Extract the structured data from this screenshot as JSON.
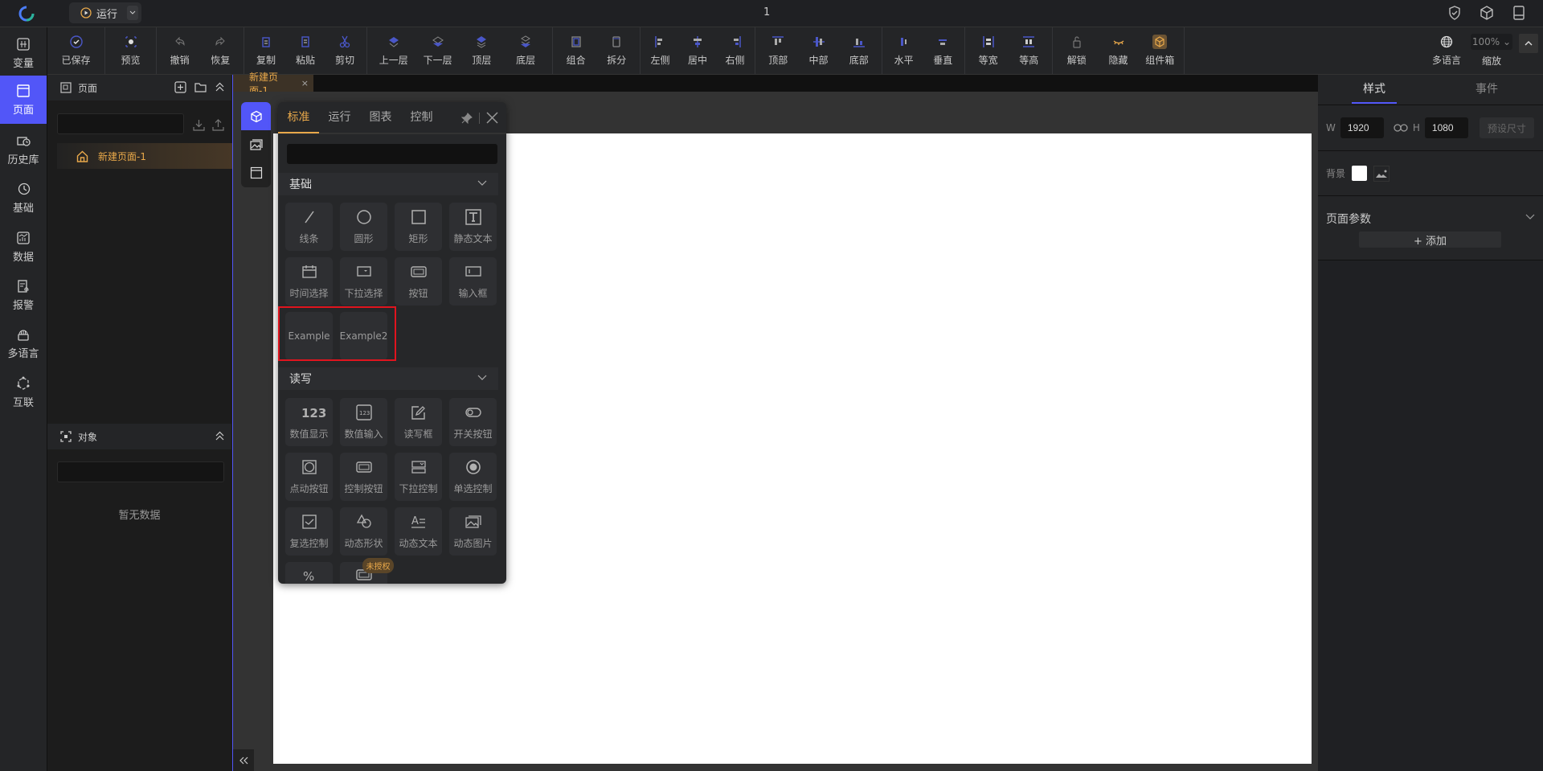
{
  "app": {
    "title": "1",
    "run_label": "运行"
  },
  "colors": {
    "accent": "#5256f8",
    "highlight": "#e8a84a",
    "danger": "#e0141e"
  },
  "toolbar": {
    "groups": [
      [
        {
          "label": "已保存",
          "icon": "check-circle-icon"
        }
      ],
      [
        {
          "label": "预览",
          "icon": "eye-icon"
        }
      ],
      [
        {
          "label": "撤销",
          "icon": "undo-icon"
        },
        {
          "label": "恢复",
          "icon": "redo-icon"
        }
      ],
      [
        {
          "label": "复制",
          "icon": "copy-icon"
        },
        {
          "label": "粘贴",
          "icon": "paste-icon"
        },
        {
          "label": "剪切",
          "icon": "scissors-icon"
        }
      ],
      [
        {
          "label": "上一层",
          "icon": "layer-up-icon"
        },
        {
          "label": "下一层",
          "icon": "layer-down-icon"
        },
        {
          "label": "顶层",
          "icon": "layer-top-icon"
        },
        {
          "label": "底层",
          "icon": "layer-bottom-icon"
        }
      ],
      [
        {
          "label": "组合",
          "icon": "group-icon"
        },
        {
          "label": "拆分",
          "icon": "ungroup-icon"
        }
      ],
      [
        {
          "label": "左侧",
          "icon": "align-left-icon"
        },
        {
          "label": "居中",
          "icon": "align-center-icon"
        },
        {
          "label": "右侧",
          "icon": "align-right-icon"
        }
      ],
      [
        {
          "label": "顶部",
          "icon": "align-top-icon"
        },
        {
          "label": "中部",
          "icon": "align-middle-icon"
        },
        {
          "label": "底部",
          "icon": "align-bottom-icon"
        }
      ],
      [
        {
          "label": "水平",
          "icon": "distribute-horizontal-icon"
        },
        {
          "label": "垂直",
          "icon": "distribute-vertical-icon"
        }
      ],
      [
        {
          "label": "等宽",
          "icon": "equal-width-icon"
        },
        {
          "label": "等高",
          "icon": "equal-height-icon"
        }
      ],
      [
        {
          "label": "解锁",
          "icon": "unlock-icon"
        },
        {
          "label": "隐藏",
          "icon": "eye-closed-icon"
        },
        {
          "label": "组件箱",
          "icon": "component-box-icon"
        }
      ]
    ],
    "language_label": "多语言",
    "zoom_label": "缩放",
    "zoom_value": "100%"
  },
  "nav": [
    {
      "label": "变量",
      "icon": "variable-icon"
    },
    {
      "label": "页面",
      "icon": "page-icon",
      "active": true
    },
    {
      "label": "历史库",
      "icon": "history-db-icon"
    },
    {
      "label": "基础",
      "icon": "clock-icon"
    },
    {
      "label": "数据",
      "icon": "chart-icon"
    },
    {
      "label": "报警",
      "icon": "alarm-icon"
    },
    {
      "label": "多语言",
      "icon": "language-icon"
    },
    {
      "label": "互联",
      "icon": "network-icon"
    }
  ],
  "pages_panel": {
    "title": "页面",
    "search_value": "",
    "items": [
      {
        "label": "新建页面-1",
        "home": true
      }
    ]
  },
  "objects_panel": {
    "title": "对象",
    "search_value": "",
    "empty_text": "暂无数据"
  },
  "editor_tabs": [
    {
      "label": "新建页面-1"
    }
  ],
  "palette": {
    "tabs": [
      {
        "label": "标准",
        "active": true
      },
      {
        "label": "运行"
      },
      {
        "label": "图表"
      },
      {
        "label": "控制"
      }
    ],
    "search_value": "",
    "sections": [
      {
        "title": "基础",
        "items": [
          {
            "label": "线条",
            "icon": "line-icon"
          },
          {
            "label": "圆形",
            "icon": "circle-icon"
          },
          {
            "label": "矩形",
            "icon": "rect-icon"
          },
          {
            "label": "静态文本",
            "icon": "text-icon"
          },
          {
            "label": "时间选择",
            "icon": "calendar-icon"
          },
          {
            "label": "下拉选择",
            "icon": "dropdown-icon"
          },
          {
            "label": "按钮",
            "icon": "button-icon"
          },
          {
            "label": "输入框",
            "icon": "input-icon"
          },
          {
            "label": "Example",
            "icon": ""
          },
          {
            "label": "Example2",
            "icon": ""
          }
        ]
      },
      {
        "title": "读写",
        "items": [
          {
            "label": "数值显示",
            "icon": "number-display-icon"
          },
          {
            "label": "数值输入",
            "icon": "number-input-icon"
          },
          {
            "label": "读写框",
            "icon": "edit-icon"
          },
          {
            "label": "开关按钮",
            "icon": "toggle-icon"
          },
          {
            "label": "点动按钮",
            "icon": "jog-button-icon"
          },
          {
            "label": "控制按钮",
            "icon": "button-icon"
          },
          {
            "label": "下拉控制",
            "icon": "dropdown-control-icon"
          },
          {
            "label": "单选控制",
            "icon": "radio-icon"
          },
          {
            "label": "复选控制",
            "icon": "checkbox-icon"
          },
          {
            "label": "动态形状",
            "icon": "shapes-icon"
          },
          {
            "label": "动态文本",
            "icon": "dynamic-text-icon"
          },
          {
            "label": "动态图片",
            "icon": "image-icon"
          },
          {
            "label": "",
            "icon": "percent-icon"
          },
          {
            "label": "",
            "icon": "button-icon"
          }
        ]
      }
    ],
    "unlicensed_badge": "未授权"
  },
  "props": {
    "tabs": [
      {
        "label": "样式",
        "active": true
      },
      {
        "label": "事件"
      }
    ],
    "width_label": "W",
    "width": "1920",
    "height_label": "H",
    "height": "1080",
    "preset_label": "预设尺寸",
    "bg_label": "背景",
    "bg_color": "#ffffff",
    "params_label": "页面参数",
    "add_label": "+ 添加"
  }
}
